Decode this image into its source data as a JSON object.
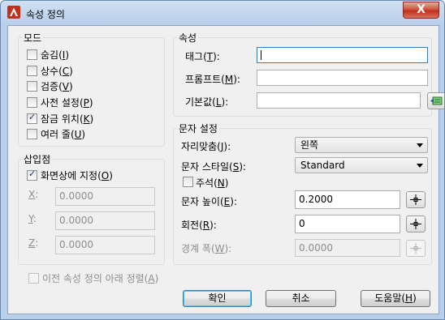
{
  "window": {
    "title": "속성 정의",
    "close_symbol": "X"
  },
  "mode": {
    "title": "모드",
    "items": [
      {
        "text": "숨김",
        "key": "I",
        "checked": false
      },
      {
        "text": "상수",
        "key": "C",
        "checked": false
      },
      {
        "text": "검증",
        "key": "V",
        "checked": false
      },
      {
        "text": "사전 설정",
        "key": "P",
        "checked": false
      },
      {
        "text": "잠금 위치",
        "key": "K",
        "checked": true
      },
      {
        "text": "여러 줄",
        "key": "U",
        "checked": false
      }
    ]
  },
  "insertion_point": {
    "title": "삽입점",
    "specify_on_screen": {
      "text": "화면상에 지정",
      "key": "O",
      "checked": true
    },
    "x": {
      "label": "X",
      "value": "0.0000"
    },
    "y": {
      "label": "Y",
      "value": "0.0000"
    },
    "z": {
      "label": "Z",
      "value": "0.0000"
    }
  },
  "align_below": {
    "text": "이전 속성 정의 아래 정렬",
    "key": "A",
    "checked": false
  },
  "attribute": {
    "title": "속성",
    "tag": {
      "text": "태그",
      "key": "T",
      "value": ""
    },
    "prompt": {
      "text": "프롬프트",
      "key": "M",
      "value": ""
    },
    "default": {
      "text": "기본값",
      "key": "L",
      "value": ""
    }
  },
  "text_settings": {
    "title": "문자 설정",
    "justification": {
      "text": "자리맞춤",
      "key": "J",
      "value": "왼쪽"
    },
    "text_style": {
      "text": "문자 스타일",
      "key": "S",
      "value": "Standard"
    },
    "annotative": {
      "text": "주석",
      "key": "N",
      "checked": false
    },
    "text_height": {
      "text": "문자 높이",
      "key": "E",
      "value": "0.2000"
    },
    "rotation": {
      "text": "회전",
      "key": "R",
      "value": "0"
    },
    "boundary_width": {
      "text": "경계 폭",
      "key": "W",
      "value": "0.0000"
    }
  },
  "buttons": {
    "ok": "확인",
    "cancel": "취소",
    "help": "도움말",
    "help_key": "H"
  },
  "colors": {
    "accent": "#c0301d",
    "title_bar": "#b9cfe9",
    "dialog_bg": "#f0f0f0",
    "checkmark": "#1c3a6e"
  },
  "icons": {
    "app": "autocad-a-icon",
    "close": "close-icon",
    "insert_field": "insert-field-icon",
    "pick": "crosshair-pick-icon"
  }
}
